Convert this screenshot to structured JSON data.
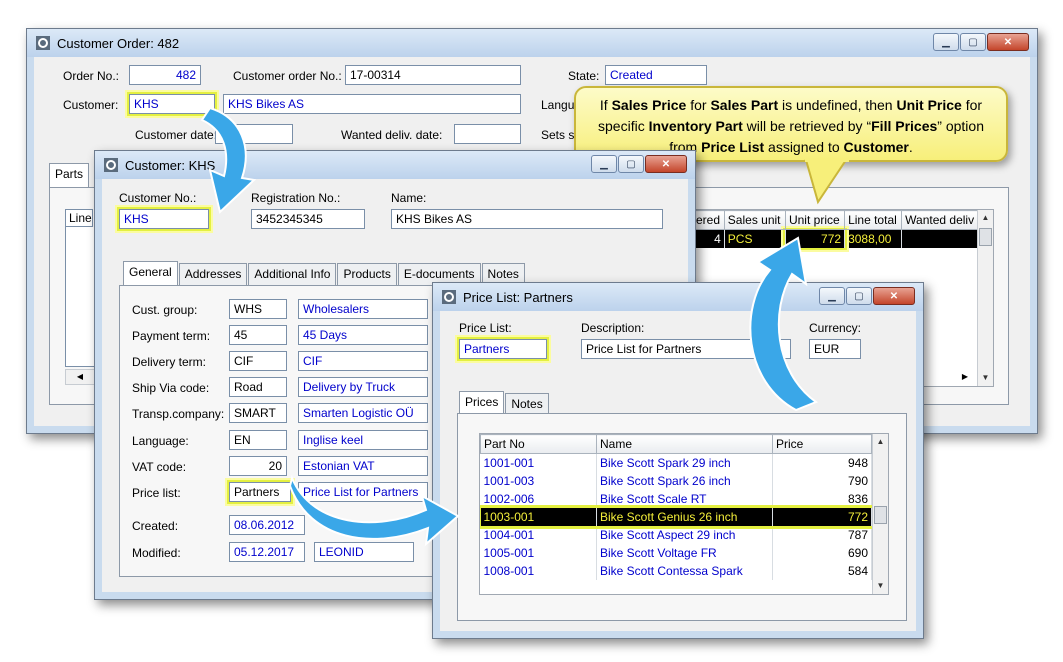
{
  "order_window": {
    "title": "Customer Order: 482",
    "order_no_label": "Order No.:",
    "order_no": "482",
    "customer_order_no_label": "Customer order No.:",
    "customer_order_no": "17-00314",
    "state_label": "State:",
    "state": "Created",
    "customer_label": "Customer:",
    "customer_code": "KHS",
    "customer_name": "KHS Bikes AS",
    "language_label": "Langu",
    "customer_date_label": "Customer date:",
    "wanted_deliv_label": "Wanted deliv. date:",
    "sets_label": "Sets s",
    "parts_tab": "Parts",
    "line_col": "Line",
    "columns": [
      "ered",
      "Sales unit",
      "Unit price",
      "Line total",
      "Wanted deliv"
    ],
    "row": {
      "ordered": "4",
      "sales_unit": "PCS",
      "unit_price": "772",
      "line_total": "3088,00",
      "wanted": ""
    }
  },
  "callout": {
    "t1": "If ",
    "b1": "Sales Price",
    "t2": " for ",
    "b2": "Sales Part",
    "t3": " is undefined, then ",
    "b3": "Unit Price",
    "t4": " for specific ",
    "b4": "Inventory Part",
    "t5": " will be retrieved by “",
    "b5": "Fill Prices",
    "t6": "” option from ",
    "b6": "Price List",
    "t7": " assigned to ",
    "b7": "Customer",
    "t8": "."
  },
  "customer_window": {
    "title": "Customer: KHS",
    "customer_no_label": "Customer No.:",
    "customer_no": "KHS",
    "registration_no_label": "Registration No.:",
    "registration_no": "3452345345",
    "name_label": "Name:",
    "name": "KHS Bikes AS",
    "tabs": [
      "General",
      "Addresses",
      "Additional Info",
      "Products",
      "E-documents",
      "Notes"
    ],
    "fields": [
      {
        "label": "Cust. group:",
        "code": "WHS",
        "desc": "Wholesalers"
      },
      {
        "label": "Payment term:",
        "code": "45",
        "desc": "45 Days"
      },
      {
        "label": "Delivery term:",
        "code": "CIF",
        "desc": "CIF"
      },
      {
        "label": "Ship Via code:",
        "code": "Road",
        "desc": "Delivery by Truck"
      },
      {
        "label": "Transp.company:",
        "code": "SMART",
        "desc": "Smarten Logistic OÜ"
      },
      {
        "label": "Language:",
        "code": "EN",
        "desc": "Inglise keel"
      },
      {
        "label": "VAT code:",
        "code": "20",
        "desc": "Estonian VAT"
      },
      {
        "label": "Price list:",
        "code": "Partners",
        "desc": "Price List for Partners"
      }
    ],
    "created_label": "Created:",
    "created": "08.06.2012",
    "modified_label": "Modified:",
    "modified": "05.12.2017",
    "modified_by": "LEONID"
  },
  "pricelist_window": {
    "title": "Price List: Partners",
    "price_list_label": "Price List:",
    "price_list": "Partners",
    "description_label": "Description:",
    "description": "Price List for Partners",
    "currency_label": "Currency:",
    "currency": "EUR",
    "tabs": [
      "Prices",
      "Notes"
    ],
    "columns": [
      "Part No",
      "Name",
      "Price"
    ],
    "rows": [
      {
        "part": "1001-001",
        "name": "Bike Scott Spark 29 inch",
        "price": "948"
      },
      {
        "part": "1001-003",
        "name": "Bike Scott Spark 26 inch",
        "price": "790"
      },
      {
        "part": "1002-006",
        "name": "Bike Scott Scale RT",
        "price": "836"
      },
      {
        "part": "1003-001",
        "name": "Bike Scott Genius 26 inch",
        "price": "772"
      },
      {
        "part": "1004-001",
        "name": "Bike Scott Aspect 29 inch",
        "price": "787"
      },
      {
        "part": "1005-001",
        "name": "Bike Scott Voltage FR",
        "price": "690"
      },
      {
        "part": "1008-001",
        "name": "Bike Scott Contessa Spark",
        "price": "584"
      }
    ]
  },
  "colors": {
    "highlight": "#e4f040",
    "link_blue": "#0000cc",
    "arrow_blue": "#3aa7e8",
    "callout_bg": "#f8f18a"
  }
}
